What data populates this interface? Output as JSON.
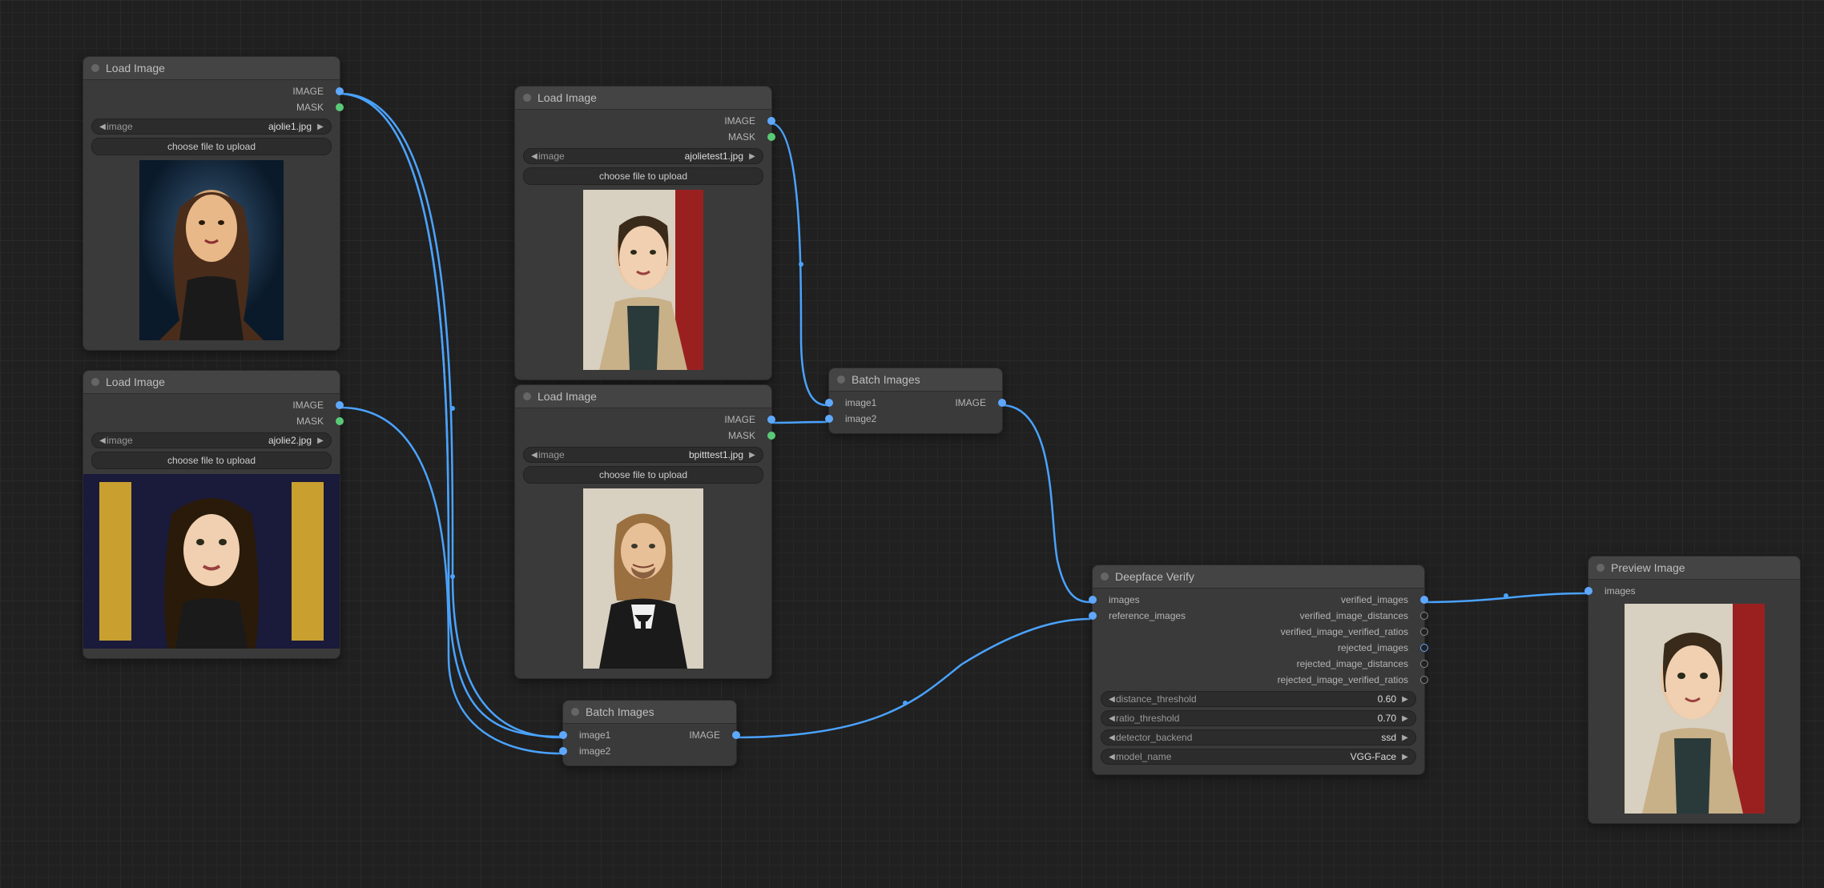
{
  "labels": {
    "output_image": "IMAGE",
    "output_mask": "MASK",
    "widget_image": "image",
    "upload_button": "choose file to upload",
    "input_image1": "image1",
    "input_image2": "image2",
    "input_images": "images",
    "input_reference_images": "reference_images",
    "out_verified_images": "verified_images",
    "out_verified_image_distances": "verified_image_distances",
    "out_verified_image_verified_ratios": "verified_image_verified_ratios",
    "out_rejected_images": "rejected_images",
    "out_rejected_image_distances": "rejected_image_distances",
    "out_rejected_image_verified_ratios": "rejected_image_verified_ratios",
    "widget_distance_threshold": "distance_threshold",
    "widget_ratio_threshold": "ratio_threshold",
    "widget_detector_backend": "detector_backend",
    "widget_model_name": "model_name"
  },
  "nodes": {
    "load1": {
      "title": "Load Image",
      "file": "ajolie1.jpg"
    },
    "load2": {
      "title": "Load Image",
      "file": "ajolie2.jpg"
    },
    "load3": {
      "title": "Load Image",
      "file": "ajolietest1.jpg"
    },
    "load4": {
      "title": "Load Image",
      "file": "bpitttest1.jpg"
    },
    "batch1": {
      "title": "Batch Images"
    },
    "batch2": {
      "title": "Batch Images"
    },
    "verify": {
      "title": "Deepface Verify",
      "distance_threshold": "0.60",
      "ratio_threshold": "0.70",
      "detector_backend": "ssd",
      "model_name": "VGG-Face"
    },
    "preview": {
      "title": "Preview Image"
    }
  }
}
